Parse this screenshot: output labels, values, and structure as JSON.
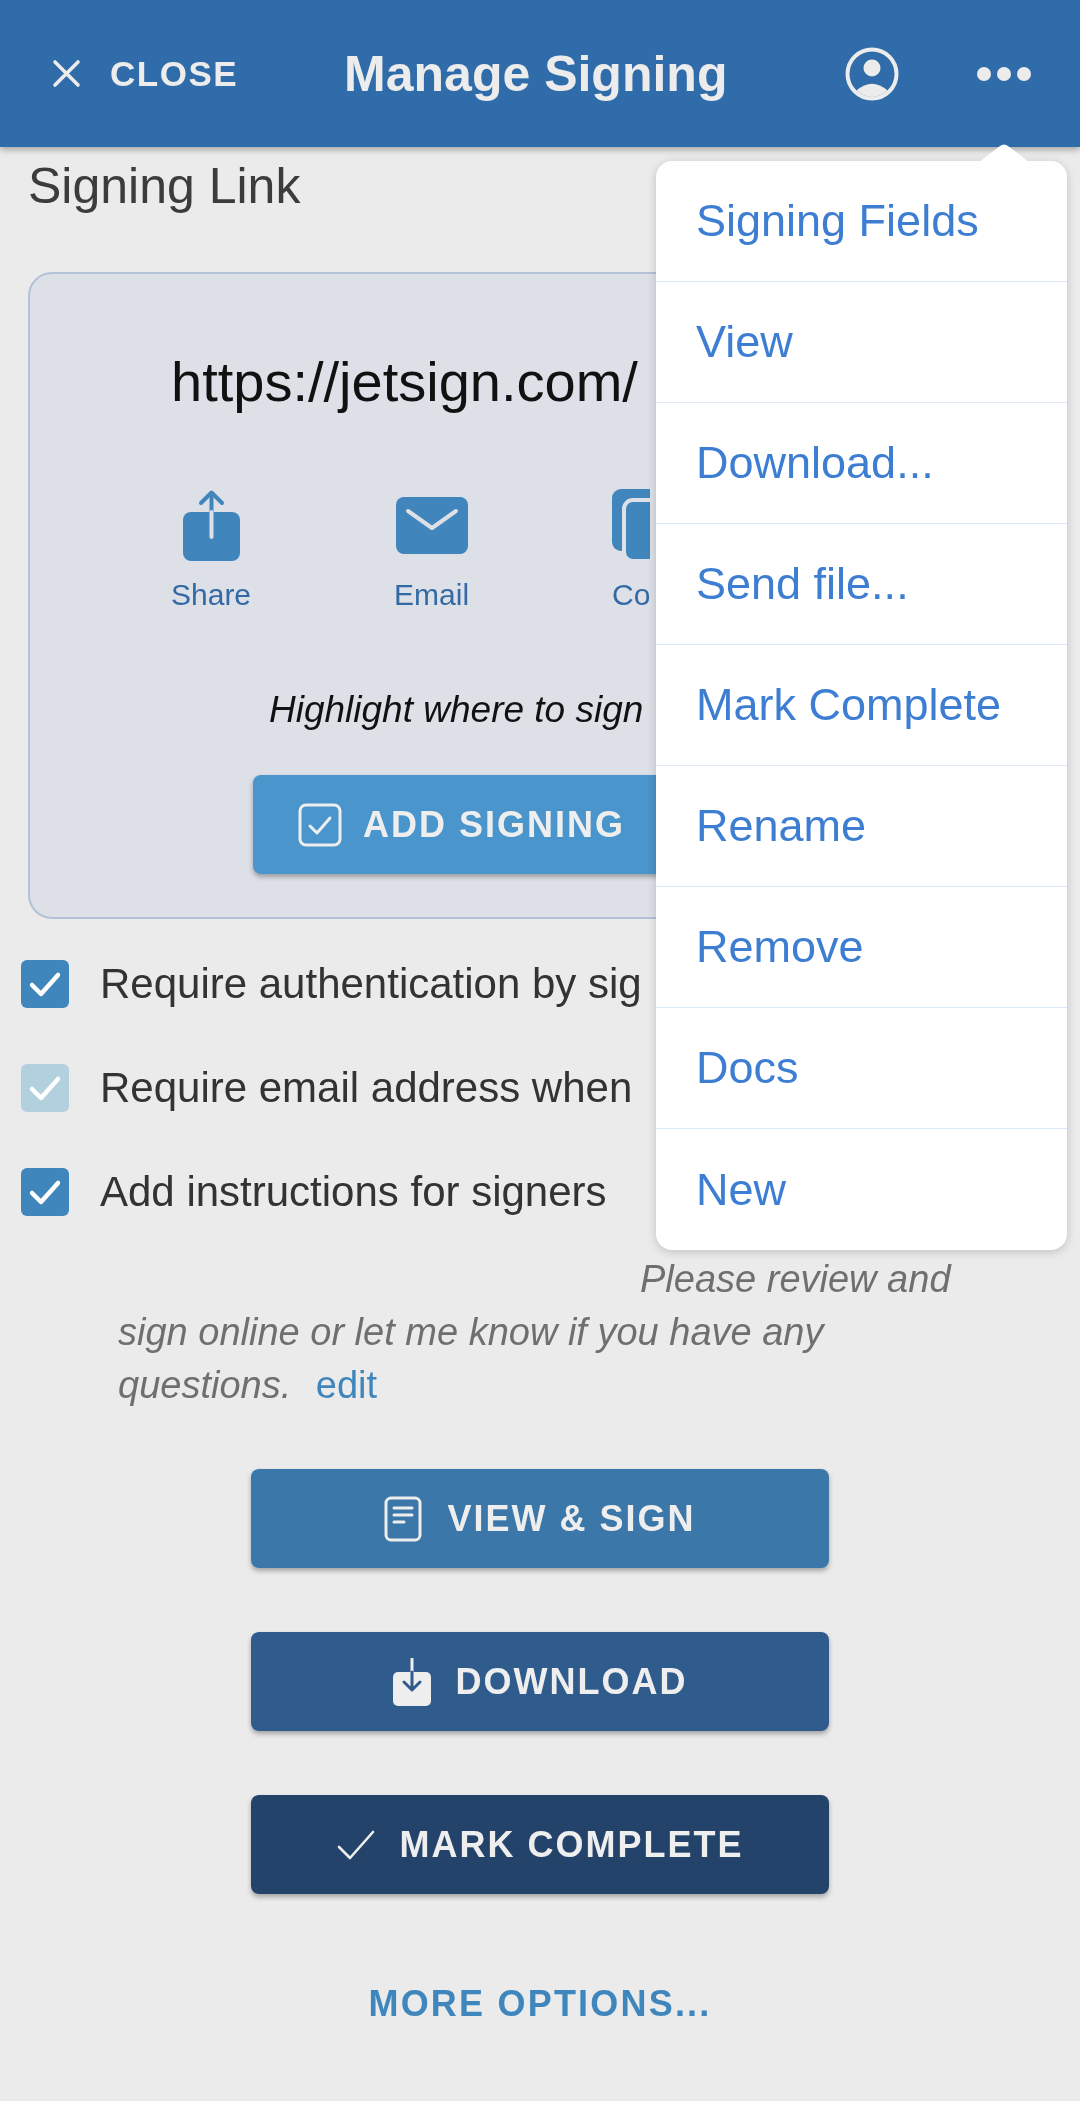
{
  "header": {
    "close_label": "CLOSE",
    "title": "Manage Signing"
  },
  "section_title": "Signing Link",
  "link_card": {
    "url": "https://jetsign.com/",
    "actions": [
      {
        "kind": "share",
        "label": "Share"
      },
      {
        "kind": "email",
        "label": "Email"
      },
      {
        "kind": "copy",
        "label": "Co"
      }
    ],
    "hint": "Highlight where to sign",
    "add_button": "ADD SIGNING"
  },
  "options": [
    {
      "label": "Require authentication by sig",
      "checked": true,
      "disabled": false
    },
    {
      "label": "Require email address when",
      "checked": true,
      "disabled": true
    },
    {
      "label": "Add instructions for signers",
      "checked": true,
      "disabled": false
    }
  ],
  "instructions": {
    "text": "Please review and sign online or let me know if you have any questions.",
    "link": "edit"
  },
  "buttons": [
    {
      "kind": "view",
      "label": "VIEW & SIGN"
    },
    {
      "kind": "download",
      "label": "DOWNLOAD"
    },
    {
      "kind": "complete",
      "label": "MARK COMPLETE"
    }
  ],
  "more_options": "MORE OPTIONS...",
  "menu": {
    "items": [
      "Signing Fields",
      "View",
      "Download...",
      "Send file...",
      "Mark Complete",
      "Rename",
      "Remove",
      "Docs",
      "New"
    ]
  }
}
